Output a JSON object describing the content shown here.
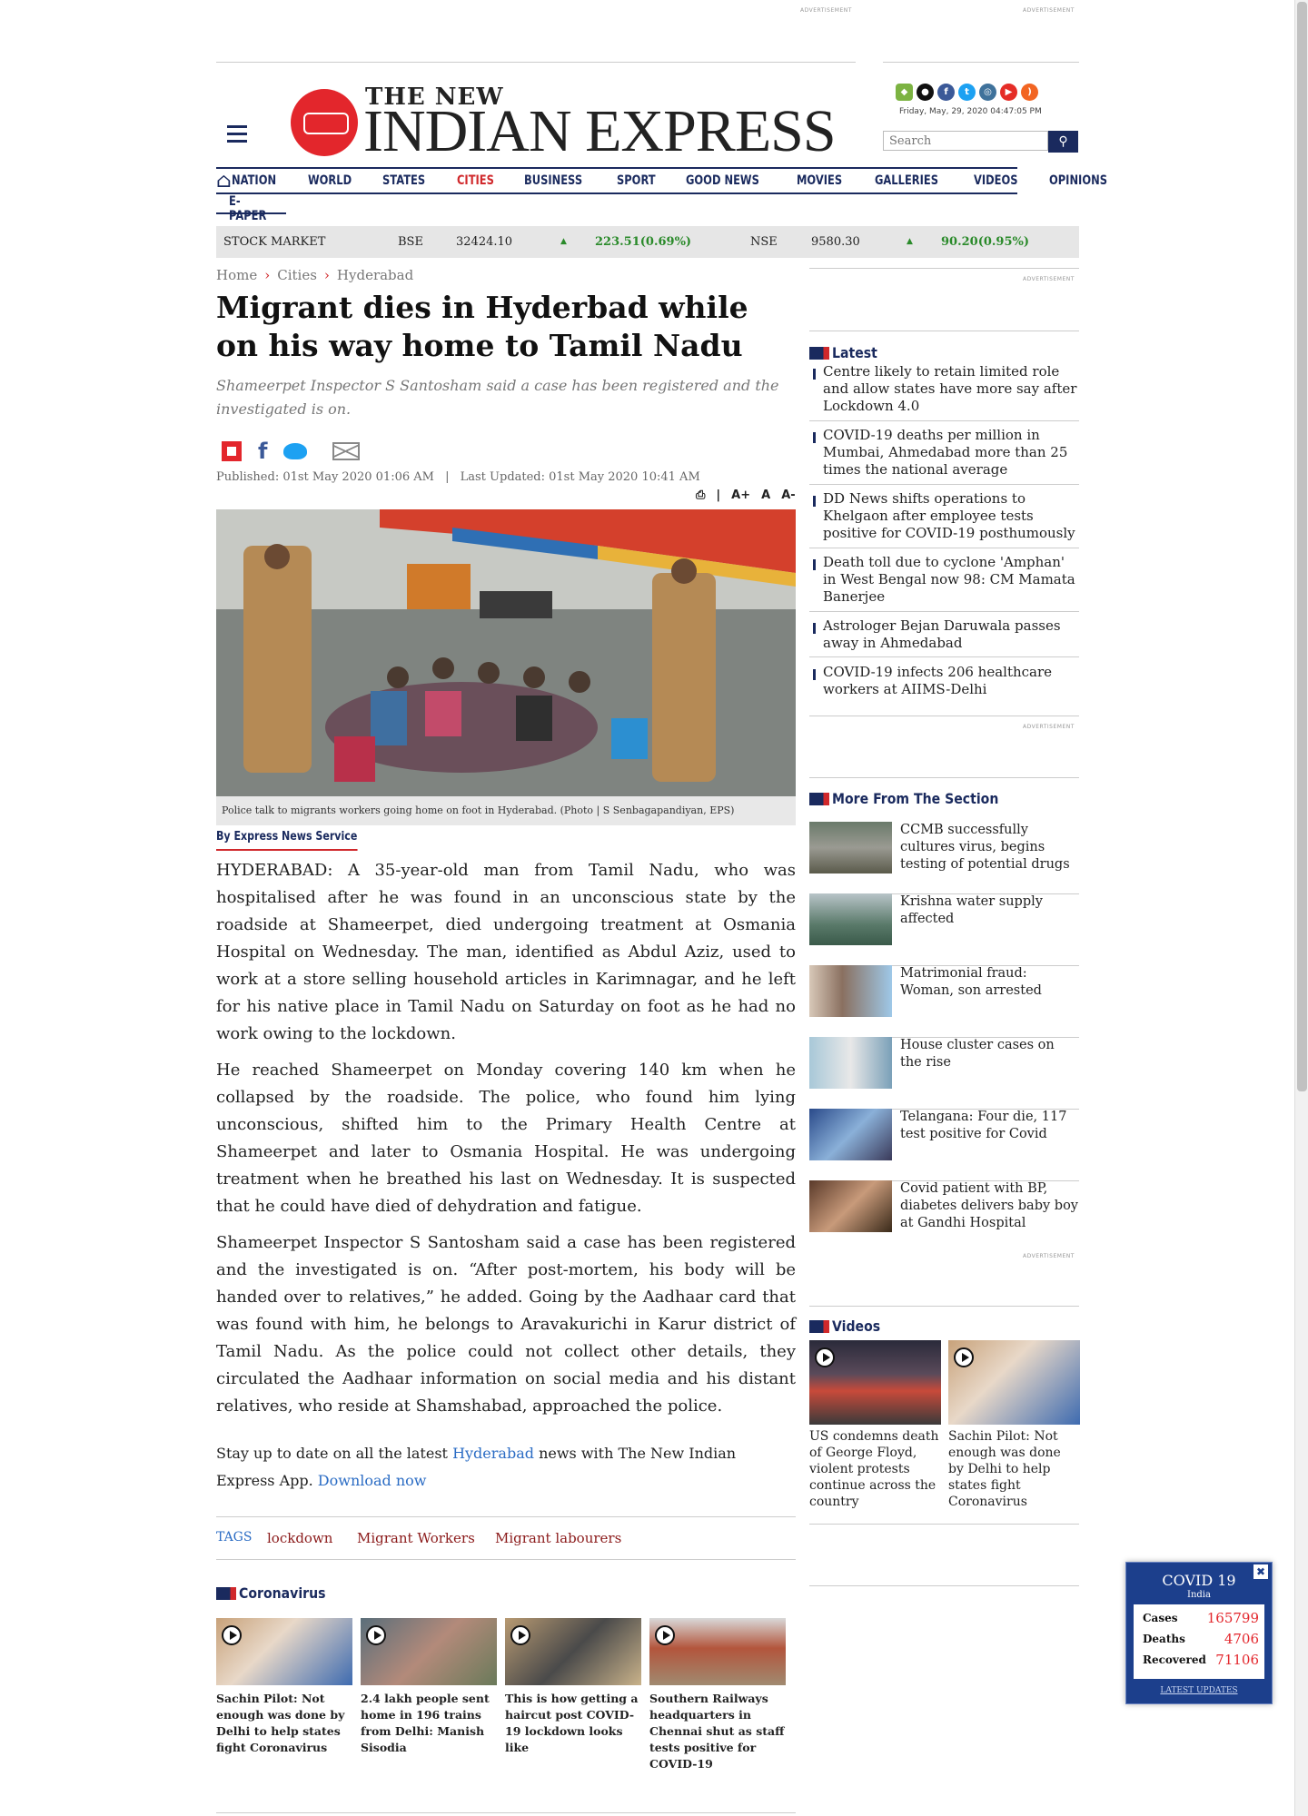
{
  "ads": {
    "label": "ADVERTISEMENT"
  },
  "header": {
    "logo_top": "THE NEW",
    "logo_main": "INDIAN EXPRESS",
    "datetime": "Friday, May, 29, 2020  04:47:05 PM",
    "search_placeholder": "Search",
    "social_icons": [
      "android-icon",
      "apple-icon",
      "facebook-icon",
      "twitter-icon",
      "instagram-icon",
      "youtube-icon",
      "rss-icon"
    ]
  },
  "nav": {
    "items": [
      "NATION",
      "WORLD",
      "STATES",
      "CITIES",
      "BUSINESS",
      "SPORT",
      "GOOD NEWS",
      "MOVIES",
      "GALLERIES",
      "VIDEOS",
      "OPINIONS"
    ],
    "second_row": "E-PAPER",
    "active": "CITIES"
  },
  "stock": {
    "label": "STOCK MARKET",
    "bse_label": "BSE",
    "bse_value": "32424.10",
    "bse_change": "223.51(0.69%)",
    "nse_label": "NSE",
    "nse_value": "9580.30",
    "nse_change": "90.20(0.95%)"
  },
  "breadcrumb": [
    "Home",
    "Cities",
    "Hyderabad"
  ],
  "article": {
    "headline": "Migrant dies in Hyderbad while on his way home to Tamil Nadu",
    "subhead": "Shameerpet Inspector S Santosham said a case has been registered and the investigated is on.",
    "published": "Published: 01st May 2020 01:06 AM",
    "updated": "Last Updated: 01st May 2020 10:41 AM",
    "font_tools": [
      "A+",
      "A",
      "A-"
    ],
    "caption": "Police talk to migrants workers going home on foot in Hyderabad. (Photo | S Senbagapandiyan, EPS)",
    "byline": "By Express News Service",
    "paragraphs": [
      "HYDERABAD:  A 35-year-old man from Tamil Nadu, who was hospitalised after he was found in an unconscious state by the roadside at Shameerpet, died undergoing treatment at Osmania Hospital on Wednesday. The man, identified as Abdul Aziz, used to work at a store selling household articles in Karimnagar, and he left for his native place in Tamil Nadu on Saturday on foot as he had no work owing to the lockdown.",
      "He reached Shameerpet on Monday covering 140 km when he collapsed by the roadside. The police, who found him lying unconscious, shifted him to the Primary Health Centre at Shameerpet and later to Osmania Hospital. He was undergoing treatment when he breathed his last on Wednesday. It is suspected that he could have died of dehydration and fatigue.",
      "Shameerpet Inspector S Santosham said a case has been registered and the investigated is on. “After post-mortem, his body will be handed over to relatives,” he added. Going by the Aadhaar card that was found with him, he belongs to Aravakurichi in Karur district of Tamil Nadu. As the police could not collect other details, they circulated the Aadhaar information on social media and his distant relatives, who reside at Shamshabad, approached the police."
    ],
    "app_prefix": "Stay up to date on all the latest ",
    "app_city": "Hyderabad",
    "app_middle": " news with The New Indian Express App. ",
    "app_link": "Download now",
    "tags_label": "TAGS",
    "tags": [
      "lockdown",
      "Migrant Workers",
      "Migrant labourers"
    ]
  },
  "coronavirus": {
    "heading": "Coronavirus",
    "cards": [
      "Sachin Pilot: Not enough was done by Delhi to help states fight Coronavirus",
      "2.4 lakh people sent home in 196 trains from Delhi: Manish Sisodia",
      "This is how getting a haircut post COVID-19 lockdown looks like",
      "Southern Railways headquarters in Chennai shut as staff tests positive for COVID-19"
    ]
  },
  "sidebar": {
    "latest_heading": "Latest",
    "latest": [
      "Centre likely to retain limited role and allow states have more say after Lockdown 4.0",
      "COVID-19 deaths per million in Mumbai, Ahmedabad more than 25 times the national average",
      "DD News shifts operations to Khelgaon after employee tests positive for COVID-19 posthumously",
      "Death toll due to cyclone 'Amphan' in West Bengal now 98: CM Mamata Banerjee",
      "Astrologer Bejan Daruwala passes away in Ahmedabad",
      "COVID-19 infects 206 healthcare workers at AIIMS-Delhi"
    ],
    "more_heading": "More From The Section",
    "more": [
      "CCMB successfully cultures virus, begins testing of potential drugs",
      "Krishna water supply affected",
      "Matrimonial fraud: Woman, son arrested",
      "House cluster cases on the rise",
      "Telangana: Four die, 117 test positive for Covid",
      "Covid patient with BP, diabetes delivers baby boy at Gandhi Hospital"
    ],
    "videos_heading": "Videos",
    "videos": [
      "US condemns death of George Floyd, violent protests continue across the country",
      "Sachin Pilot: Not enough was done by Delhi to help states fight Coronavirus"
    ]
  },
  "covid_widget": {
    "title": "COVID 19",
    "region": "India",
    "rows": [
      {
        "label": "Cases",
        "value": "165799"
      },
      {
        "label": "Deaths",
        "value": "4706"
      },
      {
        "label": "Recovered",
        "value": "71106"
      }
    ],
    "link": "LATEST UPDATES",
    "close": "✖"
  },
  "colors": {
    "brand_red": "#e3262c",
    "navy": "#1a2a5e",
    "green": "#2a8a2a"
  }
}
